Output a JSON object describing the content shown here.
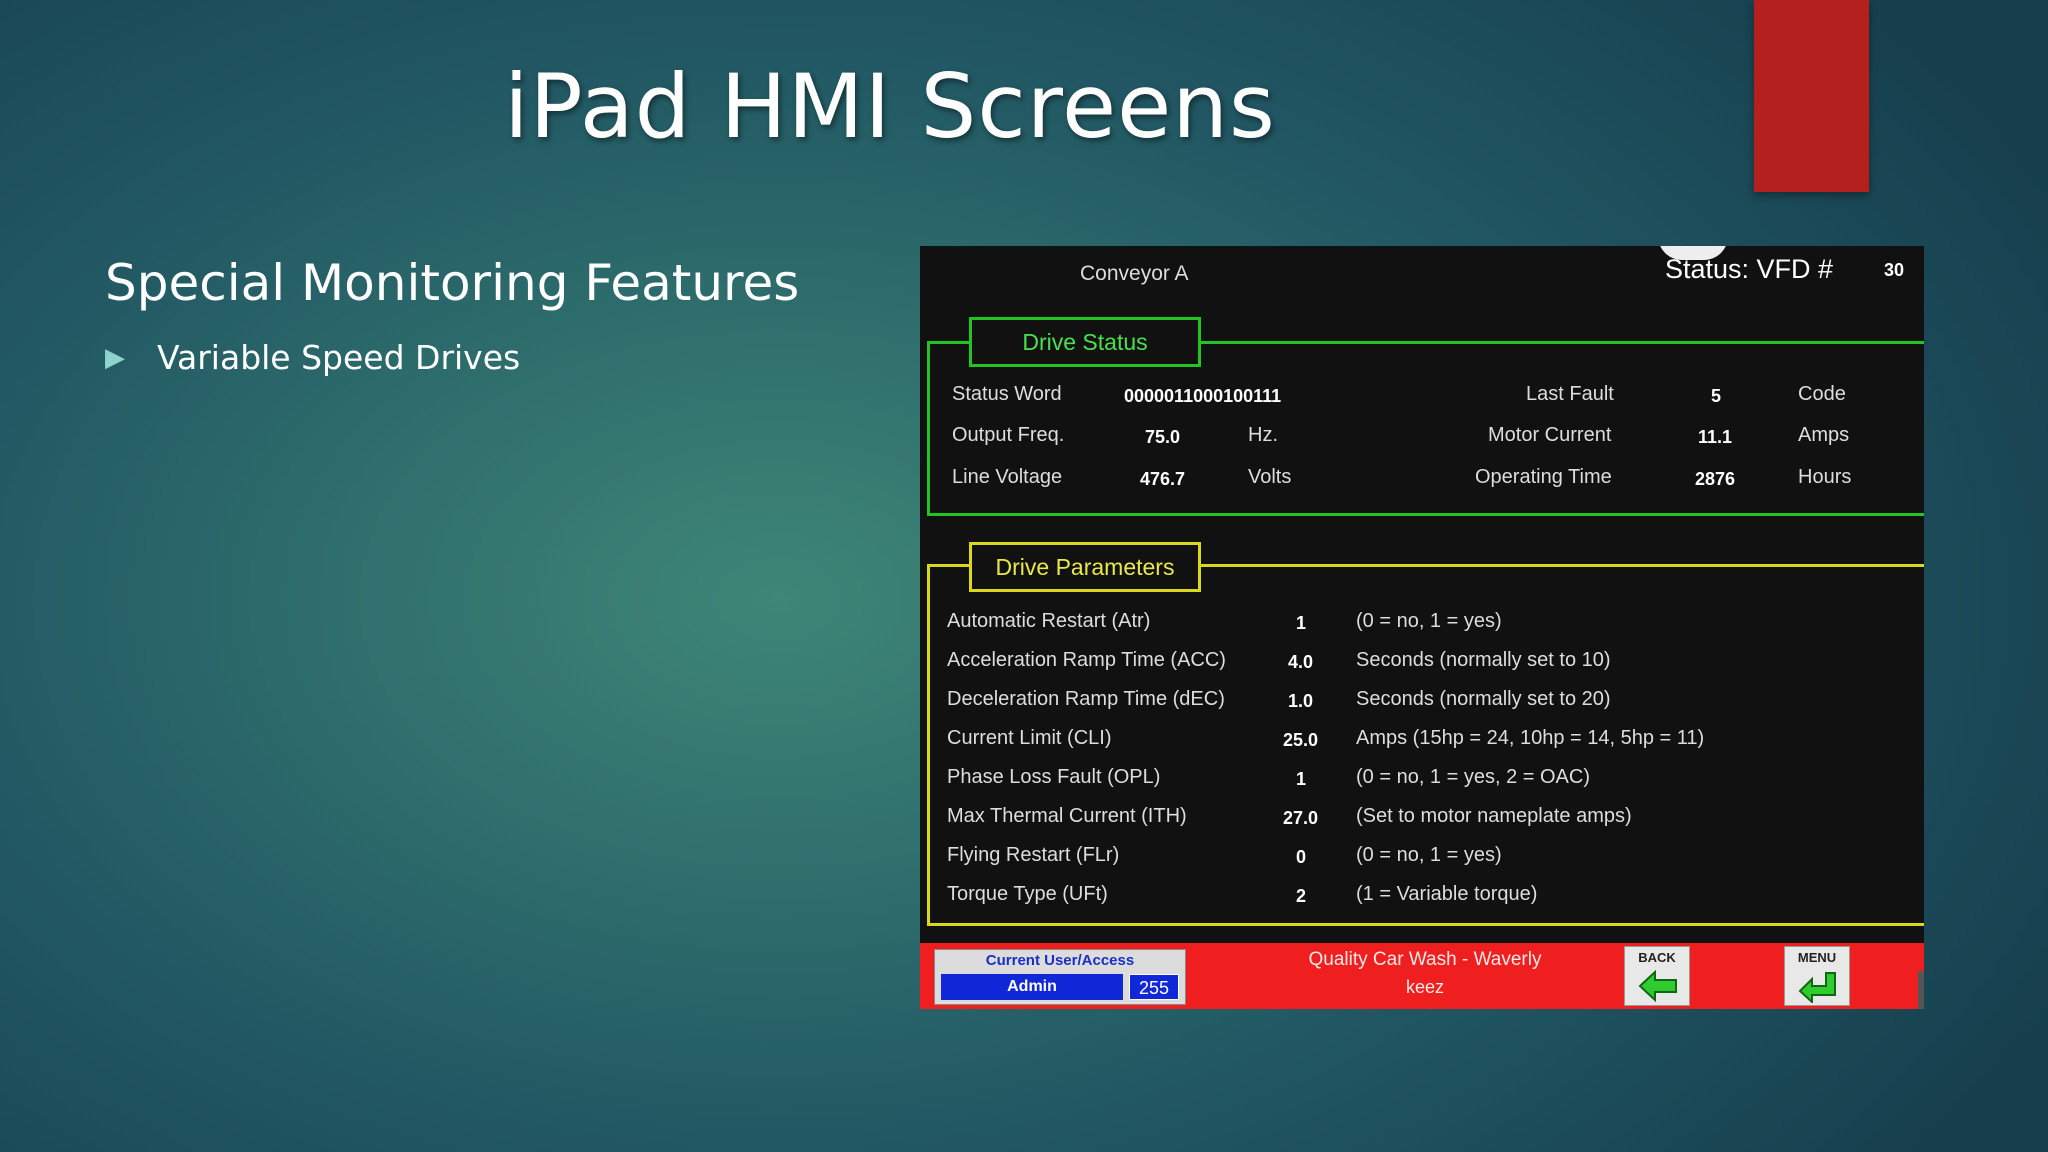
{
  "slide": {
    "title": "iPad HMI Screens",
    "subtitle": "Special Monitoring Features",
    "bullet": "Variable Speed Drives",
    "accent_color": "#b3201e"
  },
  "hmi": {
    "header": {
      "location": "Conveyor A",
      "status_label": "Status: VFD #",
      "vfd_number": "30"
    },
    "drive_status": {
      "title": "Drive Status",
      "left": [
        {
          "label": "Status Word",
          "value": "0000011000100111",
          "unit": ""
        },
        {
          "label": "Output Freq.",
          "value": "75.0",
          "unit": "Hz."
        },
        {
          "label": "Line Voltage",
          "value": "476.7",
          "unit": "Volts"
        }
      ],
      "right": [
        {
          "label": "Last Fault",
          "value": "5",
          "unit": "Code"
        },
        {
          "label": "Motor Current",
          "value": "11.1",
          "unit": "Amps"
        },
        {
          "label": "Operating Time",
          "value": "2876",
          "unit": "Hours"
        }
      ]
    },
    "drive_parameters": {
      "title": "Drive Parameters",
      "rows": [
        {
          "label": "Automatic Restart (Atr)",
          "value": "1",
          "note": "(0 = no, 1 = yes)"
        },
        {
          "label": "Acceleration Ramp Time (ACC)",
          "value": "4.0",
          "note": "Seconds (normally set to 10)"
        },
        {
          "label": "Deceleration Ramp Time (dEC)",
          "value": "1.0",
          "note": "Seconds (normally set to 20)"
        },
        {
          "label": "Current Limit (CLI)",
          "value": "25.0",
          "note": "Amps (15hp = 24, 10hp = 14, 5hp = 11)"
        },
        {
          "label": "Phase Loss Fault (OPL)",
          "value": "1",
          "note": "(0 = no, 1 = yes, 2 = OAC)"
        },
        {
          "label": "Max Thermal Current (ITH)",
          "value": "27.0",
          "note": "(Set to motor nameplate amps)"
        },
        {
          "label": "Flying Restart (FLr)",
          "value": "0",
          "note": "(0 = no, 1 = yes)"
        },
        {
          "label": "Torque Type (UFt)",
          "value": "2",
          "note": "(1 = Variable torque)"
        }
      ]
    },
    "footer": {
      "user_header": "Current User/Access",
      "user_name": "Admin",
      "access_level": "255",
      "site": "Quality Car Wash - Waverly",
      "site_user": "keez",
      "back_label": "BACK",
      "menu_label": "MENU",
      "footer_color": "#f01f1f"
    }
  }
}
